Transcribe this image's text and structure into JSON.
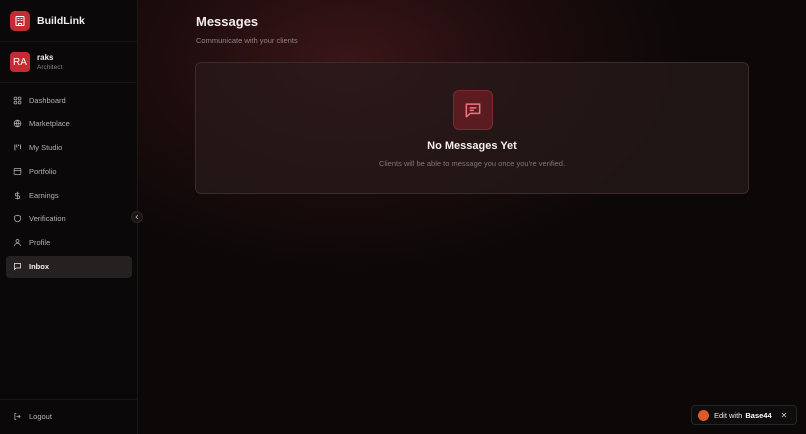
{
  "app": {
    "name": "BuildLink"
  },
  "user": {
    "initials": "RA",
    "name": "raks",
    "role": "Architect"
  },
  "nav": {
    "items": [
      {
        "label": "Dashboard",
        "icon": "grid-icon",
        "active": false
      },
      {
        "label": "Marketplace",
        "icon": "globe-icon",
        "active": false
      },
      {
        "label": "My Studio",
        "icon": "studio-icon",
        "active": false
      },
      {
        "label": "Portfolio",
        "icon": "portfolio-icon",
        "active": false
      },
      {
        "label": "Earnings",
        "icon": "dollar-icon",
        "active": false
      },
      {
        "label": "Verification",
        "icon": "shield-icon",
        "active": false
      },
      {
        "label": "Profile",
        "icon": "user-icon",
        "active": false
      },
      {
        "label": "Inbox",
        "icon": "chat-icon",
        "active": true
      }
    ],
    "logout": "Logout"
  },
  "page": {
    "title": "Messages",
    "subtitle": "Communicate with your clients"
  },
  "empty_state": {
    "icon": "message-square-icon",
    "title": "No Messages Yet",
    "text": "Clients will be able to message you once you're verified."
  },
  "badge": {
    "prefix": "Edit with",
    "brand": "Base44",
    "close": "✕"
  },
  "colors": {
    "accent": "#c42b33",
    "background": "#0b0707",
    "active_nav": "#262121"
  }
}
